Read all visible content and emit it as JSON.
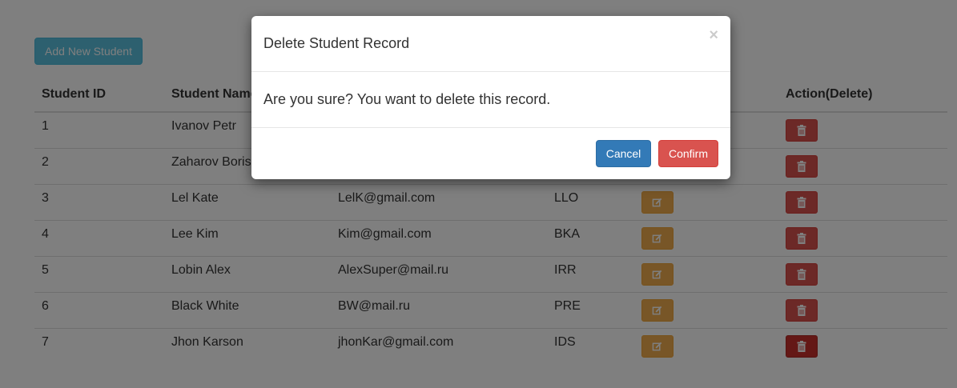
{
  "toolbar": {
    "add_label": "Add New Student"
  },
  "table": {
    "headers": [
      "Student ID",
      "Student Name",
      "",
      "",
      "",
      "Action(Delete)"
    ],
    "rows": [
      {
        "id": "1",
        "name": "Ivanov Petr",
        "email": "",
        "dept": ""
      },
      {
        "id": "2",
        "name": "Zaharov Boris",
        "email": "",
        "dept": ""
      },
      {
        "id": "3",
        "name": "Lel Kate",
        "email": "LelK@gmail.com",
        "dept": "LLO"
      },
      {
        "id": "4",
        "name": "Lee Kim",
        "email": "Kim@gmail.com",
        "dept": "BKA"
      },
      {
        "id": "5",
        "name": "Lobin Alex",
        "email": "AlexSuper@mail.ru",
        "dept": "IRR"
      },
      {
        "id": "6",
        "name": "Black White",
        "email": "BW@mail.ru",
        "dept": "PRE"
      },
      {
        "id": "7",
        "name": "Jhon Karson",
        "email": "jhonKar@gmail.com",
        "dept": "IDS"
      }
    ]
  },
  "modal": {
    "title": "Delete Student Record",
    "close": "×",
    "message": "Are you sure? You want to delete this record.",
    "cancel_label": "Cancel",
    "confirm_label": "Confirm"
  },
  "icons": {
    "edit": "edit-icon",
    "delete": "trash-icon",
    "close": "close-icon"
  },
  "colors": {
    "info": "#5bc0de",
    "primary": "#337ab7",
    "danger": "#d9534f",
    "warning": "#f0ad4e"
  }
}
